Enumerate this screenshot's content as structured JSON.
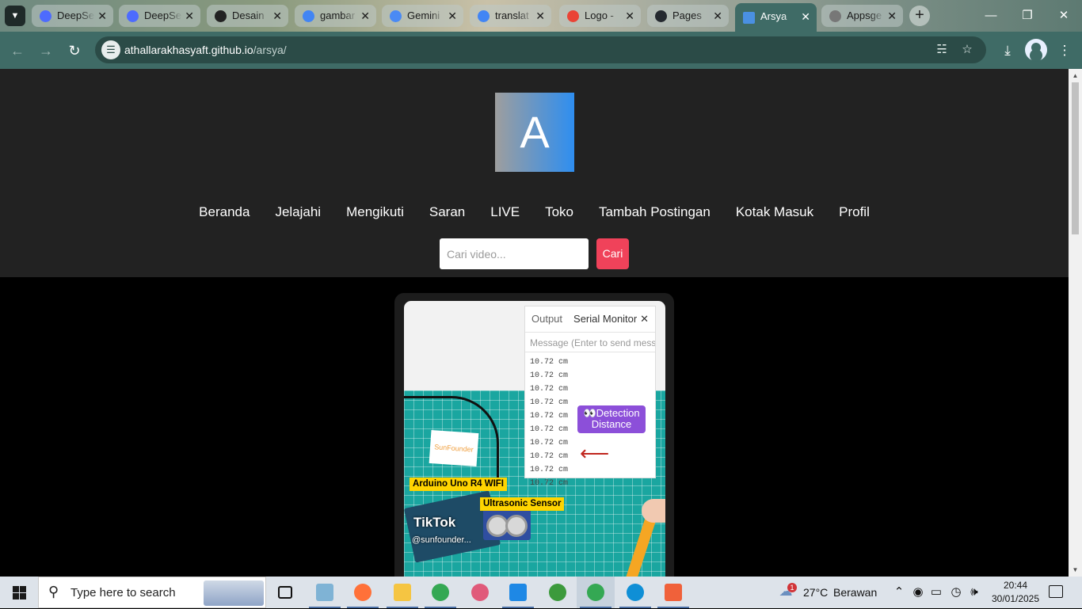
{
  "browser": {
    "tabs": [
      {
        "title": "DeepSeek",
        "color": "#4d6bfe"
      },
      {
        "title": "DeepSeek",
        "color": "#4d6bfe"
      },
      {
        "title": "Desain",
        "color": "#222222"
      },
      {
        "title": "gambar",
        "color": "#4285f4"
      },
      {
        "title": "Gemini",
        "color": "#4a8af4"
      },
      {
        "title": "translat",
        "color": "#4285f4"
      },
      {
        "title": "Logo -",
        "color": "#ea4335"
      },
      {
        "title": "Pages",
        "color": "#24292f"
      },
      {
        "title": "Arsya",
        "color": "#4a90e2"
      },
      {
        "title": "Appsge",
        "color": "#777777"
      }
    ],
    "active_tab_index": 8,
    "url_host": "athallarakhasyaft.github.io",
    "url_path": "/arsya/"
  },
  "site": {
    "logo_letter": "A",
    "nav": [
      "Beranda",
      "Jelajahi",
      "Mengikuti",
      "Saran",
      "LIVE",
      "Toko",
      "Tambah Postingan",
      "Kotak Masuk",
      "Profil"
    ],
    "search_placeholder": "Cari video...",
    "search_button": "Cari"
  },
  "video": {
    "serial_tab_output": "Output",
    "serial_tab_monitor": "Serial Monitor",
    "serial_input_placeholder": "Message (Enter to send mess",
    "serial_lines": [
      "10.72 cm",
      "10.72 cm",
      "10.72 cm",
      "10.72 cm",
      "10.72 cm",
      "10.72 cm",
      "10.72 cm",
      "10.72 cm",
      "10.72 cm",
      "10.72 cm"
    ],
    "badge_line1": "👀Detection",
    "badge_line2": "Distance",
    "label_board": "Arduino Uno R4 WIFI",
    "label_sensor": "Ultrasonic Sensor",
    "paper_text": "SunFounder",
    "watermark_app": "TikTok",
    "watermark_handle": "@sunfounder..."
  },
  "taskbar": {
    "search_placeholder": "Type here to search",
    "weather_temp": "27°C",
    "weather_text": "Berawan",
    "weather_alert": "1",
    "time": "20:44",
    "date": "30/01/2025",
    "apps": [
      {
        "name": "task-view",
        "color": "#111111"
      },
      {
        "name": "notepad-plus",
        "color": "#7fb3d5"
      },
      {
        "name": "firefox",
        "color": "#ff7139"
      },
      {
        "name": "file-explorer",
        "color": "#f5c542"
      },
      {
        "name": "chrome",
        "color": "#34a853"
      },
      {
        "name": "paint-app",
        "color": "#e05a7a"
      },
      {
        "name": "vscode",
        "color": "#1e88e5"
      },
      {
        "name": "green-app",
        "color": "#3c9a3c"
      },
      {
        "name": "chrome",
        "color": "#34a853"
      },
      {
        "name": "edge",
        "color": "#0f8fd6"
      },
      {
        "name": "git-app",
        "color": "#f0613a"
      }
    ]
  }
}
